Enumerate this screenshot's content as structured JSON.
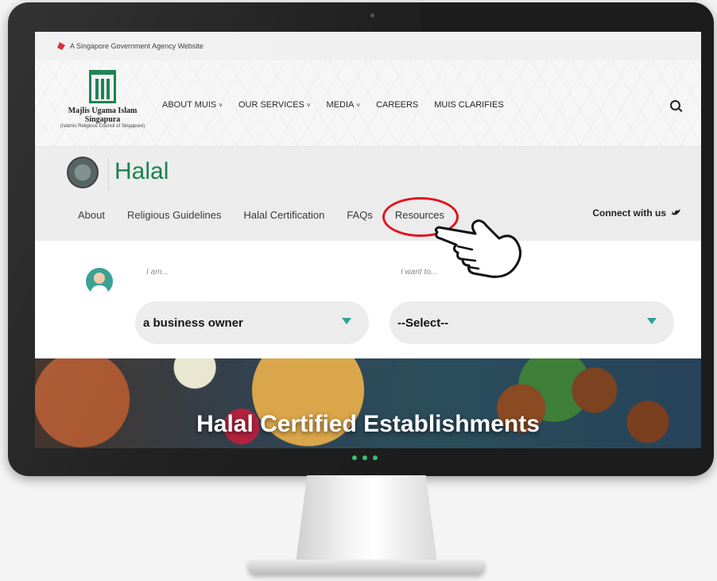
{
  "gov_banner": {
    "text": "A Singapore Government Agency Website"
  },
  "muis": {
    "logo_name": "Majlis Ugama Islam Singapura",
    "logo_sub": "(Islamic Religious Council of Singapore)",
    "nav": [
      {
        "label": "ABOUT MUIS",
        "has_dropdown": true
      },
      {
        "label": "OUR SERVICES",
        "has_dropdown": true
      },
      {
        "label": "MEDIA",
        "has_dropdown": true
      },
      {
        "label": "CAREERS",
        "has_dropdown": false
      },
      {
        "label": "MUIS CLARIFIES",
        "has_dropdown": false
      }
    ],
    "chevron": "˅",
    "search_icon": "search-icon"
  },
  "halal": {
    "title": "Halal",
    "nav": [
      "About",
      "Religious Guidelines",
      "Halal Certification",
      "FAQs",
      "Resources"
    ],
    "connect_label": "Connect with us"
  },
  "selector": {
    "i_am_label": "I am...",
    "i_am_value": "a business owner",
    "i_want_label": "I want to...",
    "i_want_value": "--Select--"
  },
  "hero": {
    "title": "Halal Certified Establishments"
  },
  "colors": {
    "brand_green": "#0e7a46",
    "highlight_red": "#e0141e",
    "teal": "#2aa48f"
  }
}
